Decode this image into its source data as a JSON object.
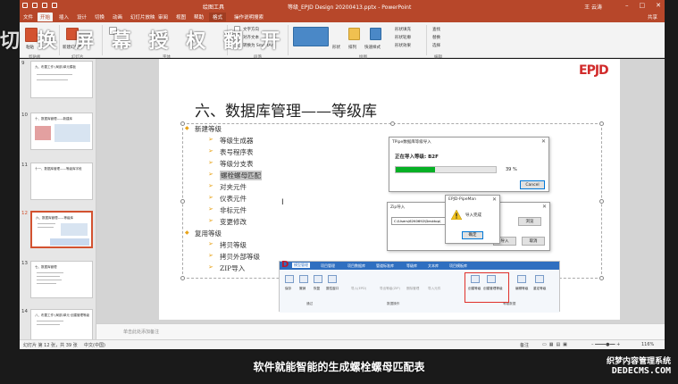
{
  "titlebar": {
    "doc_title": "等级_EPJD Design 20200413.pptx - PowerPoint",
    "context_tab": "绘图工具",
    "user": "王 云涛",
    "share": "共享"
  },
  "tabs": [
    "文件",
    "开始",
    "插入",
    "设计",
    "切换",
    "动画",
    "幻灯片放映",
    "审阅",
    "视图",
    "帮助",
    "格式",
    "操作说明搜索"
  ],
  "ribbon": {
    "overlay_text": "切 换 屏 幕 授 权 翻 开",
    "groups": [
      "剪贴板",
      "幻灯片",
      "字体",
      "段落",
      "绘图",
      "编辑"
    ],
    "items": [
      "粘贴",
      "新建幻灯片",
      "文字方向",
      "对齐文本",
      "转换为 SmartArt",
      "形状",
      "排列",
      "快速样式",
      "形状填充",
      "形状轮廓",
      "形状效果",
      "查找",
      "替换",
      "选择"
    ]
  },
  "thumbs": [
    {
      "num": "9",
      "label": "九、布置工作·(局部)单元模板"
    },
    {
      "num": "10",
      "label": "十、数据库管理——新建库"
    },
    {
      "num": "11",
      "label": "十一、数据库管理——等级库字段"
    },
    {
      "num": "12",
      "label": "六、数据库管理——等级库"
    },
    {
      "num": "13",
      "label": "七、数据库管理"
    },
    {
      "num": "14",
      "label": "八、布置工作·(局部)单元·创建管理等级"
    }
  ],
  "slide": {
    "logo": "EPJD",
    "title": "六、数据库管理——等级库",
    "bullets": [
      {
        "level": 1,
        "text": "新建等级"
      },
      {
        "level": 2,
        "text": "等级生成器"
      },
      {
        "level": 2,
        "text": "表号程序表"
      },
      {
        "level": 2,
        "text": "等级分支表"
      },
      {
        "level": 2,
        "text": "螺栓螺母匹配",
        "highlight": true
      },
      {
        "level": 2,
        "text": "对夹元件"
      },
      {
        "level": 2,
        "text": "仪表元件"
      },
      {
        "level": 2,
        "text": "非标元件"
      },
      {
        "level": 2,
        "text": "变更修改"
      },
      {
        "level": 1,
        "text": "复用等级"
      },
      {
        "level": 2,
        "text": "拷贝等级"
      },
      {
        "level": 2,
        "text": "拷贝外部等级"
      },
      {
        "level": 2,
        "text": "ZIP导入"
      }
    ]
  },
  "dialog_import": {
    "title": "TPipe数据库等级导入",
    "message": "正在导入等级: B2F",
    "percent": "39 %",
    "progress": 0.39,
    "cancel": "Cancel"
  },
  "dialog_back": {
    "title": "Zip导入",
    "path": "C:\\Users\\62K0692\\Desktop\\",
    "browse": "浏览",
    "import": "导入",
    "cancel": "取消"
  },
  "dialog_msg": {
    "title": "EPJD-PipeMan",
    "message": "导入完成",
    "ok": "确定"
  },
  "plugin": {
    "tabs": [
      "模型管理",
      "项目管理",
      "项目数据库",
      "管道标准库",
      "等级库",
      "文本库",
      "项目模板库"
    ],
    "items": [
      "保存",
      "撤销",
      "恢复",
      "属性窗口",
      "导入(EPD)",
      "导出等级(ZIP)",
      "删除管理",
      "导入元件",
      "创建等级",
      "创建管理等级",
      "编辑等级",
      "重定等级"
    ],
    "groups": [
      "通过",
      "数据操作",
      "等级数据"
    ]
  },
  "notes": {
    "placeholder": "单击此处添加备注"
  },
  "status": {
    "left": "幻灯片 第 12 张，共 39 张",
    "lang": "中文(中国)",
    "notes_btn": "备注",
    "zoom": "116%"
  },
  "caption": "软件就能智能的生成螺栓螺母匹配表",
  "watermark": {
    "line1": "织梦内容管理系统",
    "line2": "DEDECMS.COM"
  }
}
